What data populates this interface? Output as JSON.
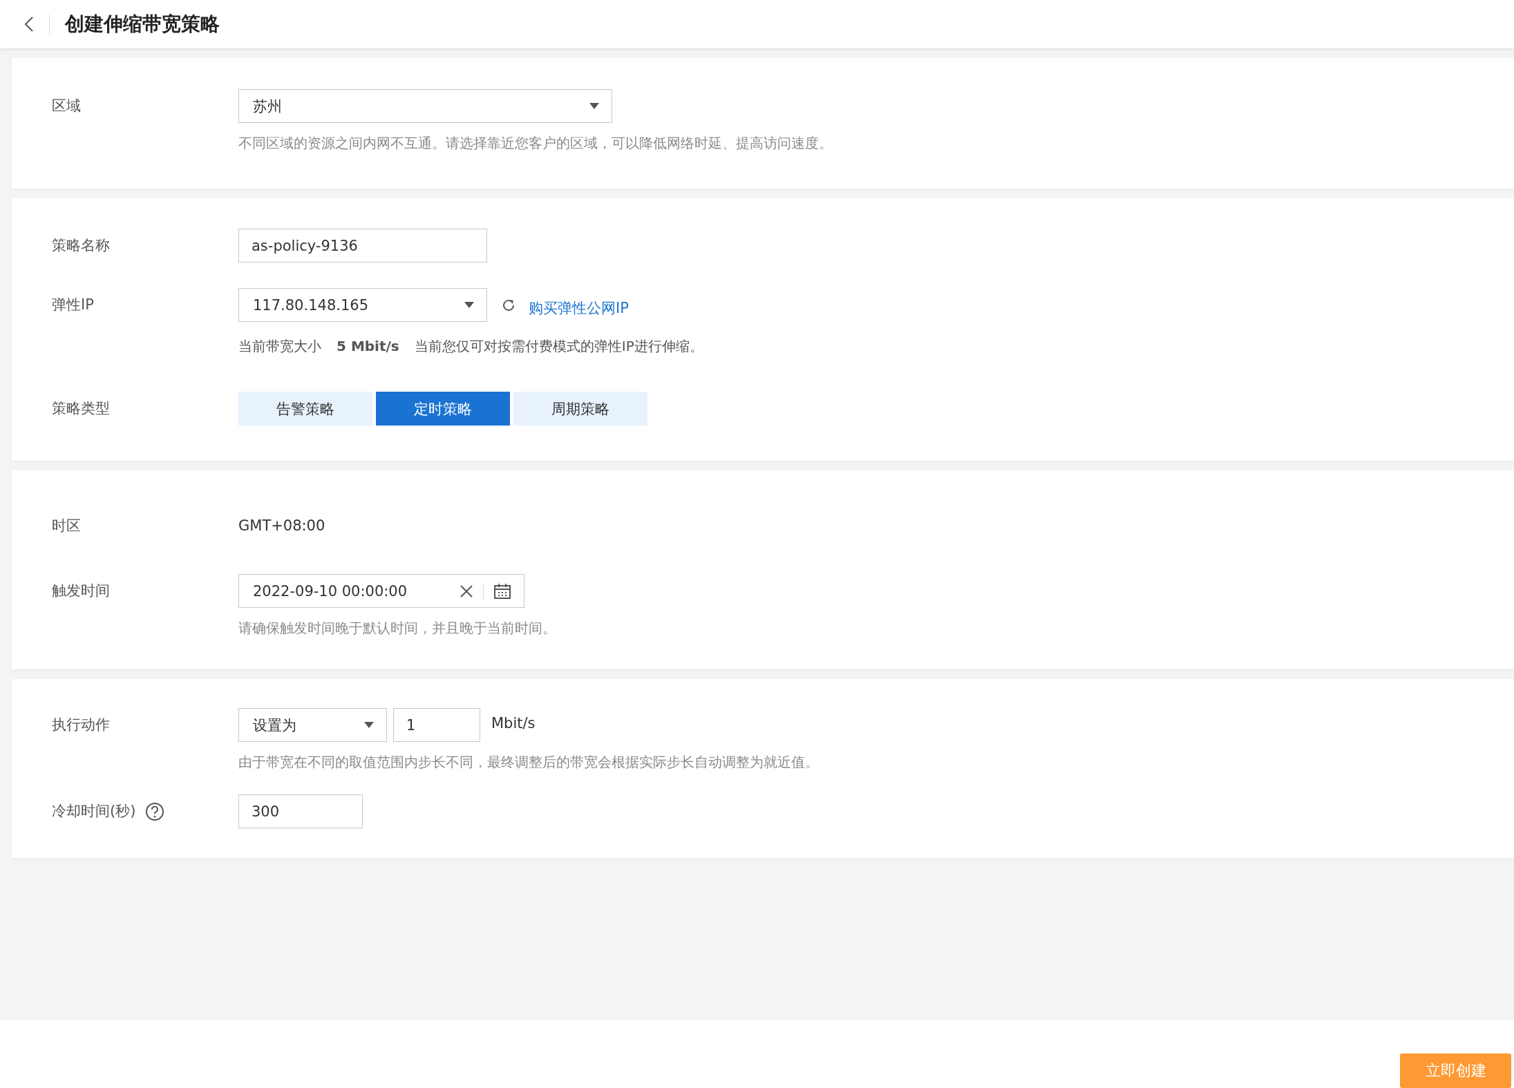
{
  "header": {
    "title": "创建伸缩带宽策略"
  },
  "region": {
    "label": "区域",
    "value": "苏州",
    "hint": "不同区域的资源之间内网不互通。请选择靠近您客户的区域，可以降低网络时延、提高访问速度。"
  },
  "policy_name": {
    "label": "策略名称",
    "value": "as-policy-9136"
  },
  "eip": {
    "label": "弹性IP",
    "value": "117.80.148.165",
    "buy_link": "购买弹性公网IP",
    "bandwidth_label": "当前带宽大小",
    "bandwidth_value": "5 Mbit/s",
    "note": "当前您仅可对按需付费模式的弹性IP进行伸缩。"
  },
  "policy_type": {
    "label": "策略类型",
    "options": [
      {
        "label": "告警策略",
        "selected": false
      },
      {
        "label": "定时策略",
        "selected": true
      },
      {
        "label": "周期策略",
        "selected": false
      }
    ]
  },
  "timezone": {
    "label": "时区",
    "value": "GMT+08:00"
  },
  "trigger": {
    "label": "触发时间",
    "value": "2022-09-10 00:00:00",
    "hint": "请确保触发时间晚于默认时间，并且晚于当前时间。"
  },
  "action": {
    "label": "执行动作",
    "mode": "设置为",
    "amount": "1",
    "unit": "Mbit/s",
    "hint": "由于带宽在不同的取值范围内步长不同，最终调整后的带宽会根据实际步长自动调整为就近值。"
  },
  "cooldown": {
    "label": "冷却时间(秒)",
    "value": "300"
  },
  "footer": {
    "create_button": "立即创建"
  }
}
